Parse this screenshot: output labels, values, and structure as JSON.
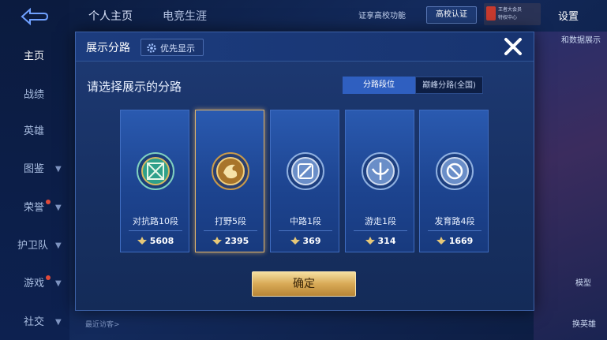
{
  "sidebar": {
    "items": [
      {
        "label": "主页",
        "chevron": false,
        "dot": false
      },
      {
        "label": "战绩",
        "chevron": false,
        "dot": false
      },
      {
        "label": "英雄",
        "chevron": false,
        "dot": false
      },
      {
        "label": "图鉴",
        "chevron": true,
        "dot": false
      },
      {
        "label": "荣誉",
        "chevron": true,
        "dot": true
      },
      {
        "label": "护卫队",
        "chevron": true,
        "dot": false
      },
      {
        "label": "游戏",
        "chevron": true,
        "dot": true
      },
      {
        "label": "社交",
        "chevron": true,
        "dot": false
      }
    ]
  },
  "topbar": {
    "tab1": "个人主页",
    "tab2": "电竞生涯",
    "note": "证享高校功能",
    "campus": "高校认证",
    "vip_line1": "王者大会员",
    "vip_line2": "特权中心",
    "settings": "设置"
  },
  "right": {
    "data_text": "和数据展示",
    "model": "模型",
    "change": "换英雄"
  },
  "bottom": {
    "recent": "最近访客>"
  },
  "modal": {
    "title": "展示分路",
    "priority": "优先显示",
    "subtitle": "请选择展示的分路",
    "tabs": [
      "分路段位",
      "巅峰分路(全国)"
    ],
    "confirm": "确定",
    "cards": [
      {
        "name": "对抗路10段",
        "score": "5608",
        "icon": "clash-lane-icon",
        "selected": false
      },
      {
        "name": "打野5段",
        "score": "2395",
        "icon": "jungle-icon",
        "selected": true
      },
      {
        "name": "中路1段",
        "score": "369",
        "icon": "mid-lane-icon",
        "selected": false
      },
      {
        "name": "游走1段",
        "score": "314",
        "icon": "roam-icon",
        "selected": false
      },
      {
        "name": "发育路4段",
        "score": "1669",
        "icon": "farm-lane-icon",
        "selected": false
      }
    ]
  },
  "colors": {
    "accent": "#2f5fc0",
    "gold": "#d8a956",
    "selected_border": "#e0b46a"
  }
}
